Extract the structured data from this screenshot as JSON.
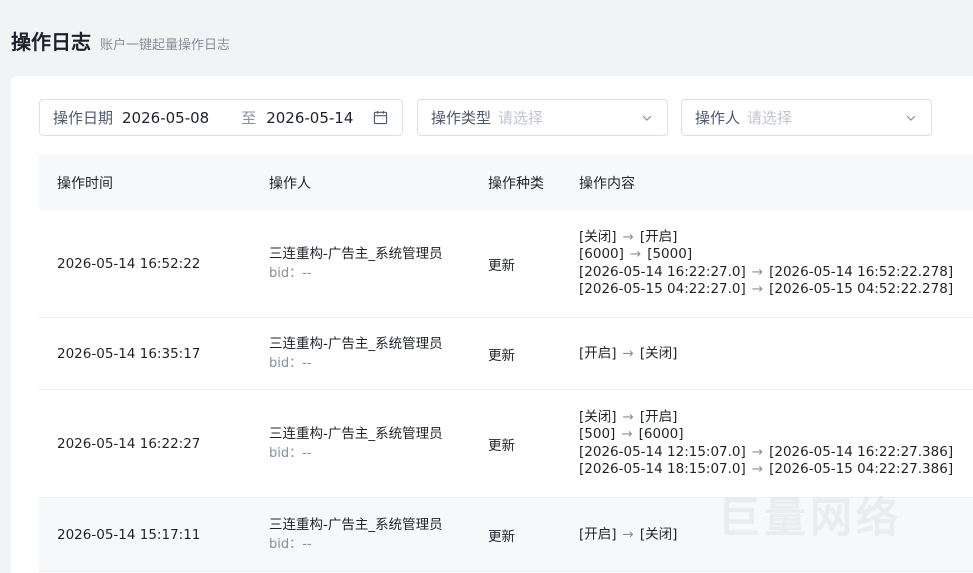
{
  "header": {
    "title": "操作日志",
    "subtitle": "账户一键起量操作日志"
  },
  "filters": {
    "date": {
      "label": "操作日期",
      "start": "2026-05-08",
      "separator": "至",
      "end": "2026-05-14"
    },
    "type": {
      "label": "操作类型",
      "placeholder": "请选择"
    },
    "user": {
      "label": "操作人",
      "placeholder": "请选择"
    }
  },
  "table": {
    "columns": [
      "操作时间",
      "操作人",
      "操作种类",
      "操作内容"
    ],
    "rows": [
      {
        "time": "2026-05-14 16:52:22",
        "user": "三连重构-广告主_系统管理员",
        "bid": "bid：--",
        "kind": "更新",
        "changes": [
          {
            "from": "[关闭]",
            "to": "[开启]"
          },
          {
            "from": "[6000]",
            "to": "[5000]"
          },
          {
            "from": "[2026-05-14 16:22:27.0]",
            "to": "[2026-05-14 16:52:22.278]"
          },
          {
            "from": "[2026-05-15 04:22:27.0]",
            "to": "[2026-05-15 04:52:22.278]"
          }
        ]
      },
      {
        "time": "2026-05-14 16:35:17",
        "user": "三连重构-广告主_系统管理员",
        "bid": "bid：--",
        "kind": "更新",
        "changes": [
          {
            "from": "[开启]",
            "to": "[关闭]"
          }
        ]
      },
      {
        "time": "2026-05-14 16:22:27",
        "user": "三连重构-广告主_系统管理员",
        "bid": "bid：--",
        "kind": "更新",
        "changes": [
          {
            "from": "[关闭]",
            "to": "[开启]"
          },
          {
            "from": "[500]",
            "to": "[6000]"
          },
          {
            "from": "[2026-05-14 12:15:07.0]",
            "to": "[2026-05-14 16:22:27.386]"
          },
          {
            "from": "[2026-05-14 18:15:07.0]",
            "to": "[2026-05-15 04:22:27.386]"
          }
        ]
      },
      {
        "time": "2026-05-14 15:17:11",
        "user": "三连重构-广告主_系统管理员",
        "bid": "bid：--",
        "kind": "更新",
        "changes": [
          {
            "from": "[开启]",
            "to": "[关闭]"
          }
        ]
      }
    ],
    "arrow": "→"
  },
  "icons": {
    "calendar": "calendar-icon",
    "dropdown": "chevron-down-icon"
  },
  "watermark": "巨量网络"
}
